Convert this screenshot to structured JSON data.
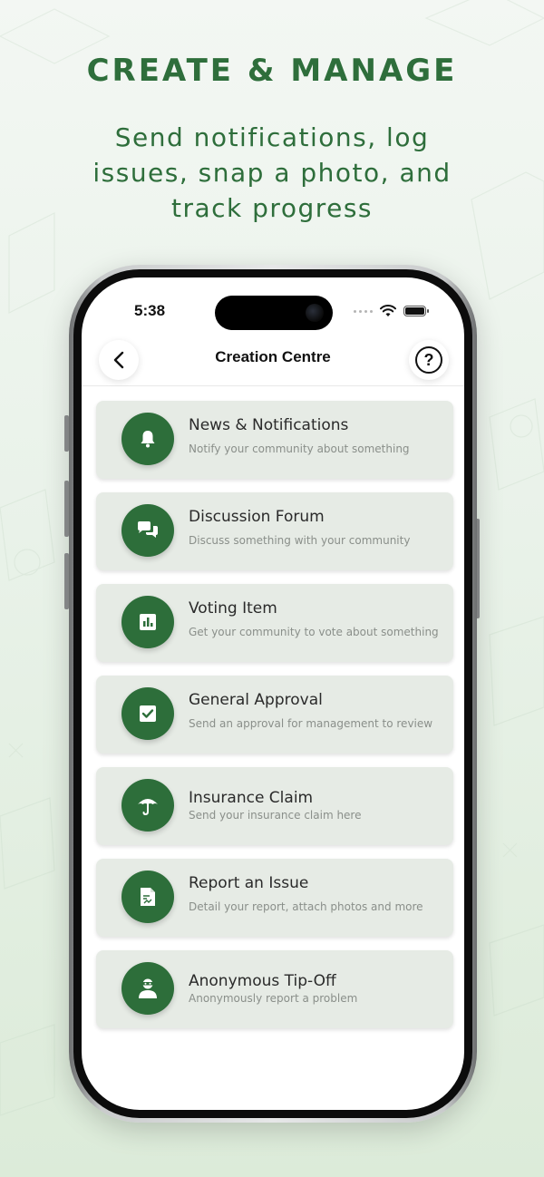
{
  "headline": "CREATE & MANAGE",
  "subhead": "Send notifications, log issues, snap a photo, and track progress",
  "status_bar": {
    "time": "5:38"
  },
  "nav": {
    "title": "Creation Centre",
    "help": "?"
  },
  "items": [
    {
      "title": "News & Notifications",
      "subtitle": "Notify your community about something",
      "icon": "bell-icon"
    },
    {
      "title": "Discussion Forum",
      "subtitle": "Discuss something with your community",
      "icon": "chat-bubbles-icon"
    },
    {
      "title": "Voting Item",
      "subtitle": "Get your community to vote about something",
      "icon": "bar-chart-icon"
    },
    {
      "title": "General Approval",
      "subtitle": "Send an approval for management to review",
      "icon": "checkbox-icon"
    },
    {
      "title": "Insurance Claim",
      "subtitle": "Send your insurance claim here",
      "icon": "umbrella-icon"
    },
    {
      "title": "Report an Issue",
      "subtitle": "Detail your report, attach photos and more",
      "icon": "document-icon"
    },
    {
      "title": "Anonymous Tip-Off",
      "subtitle": "Anonymously report a problem",
      "icon": "masked-person-icon"
    }
  ],
  "colors": {
    "brand_green": "#2d6e3a",
    "card_bg": "#e6ebe5",
    "headline_green": "#2e6e3b"
  }
}
